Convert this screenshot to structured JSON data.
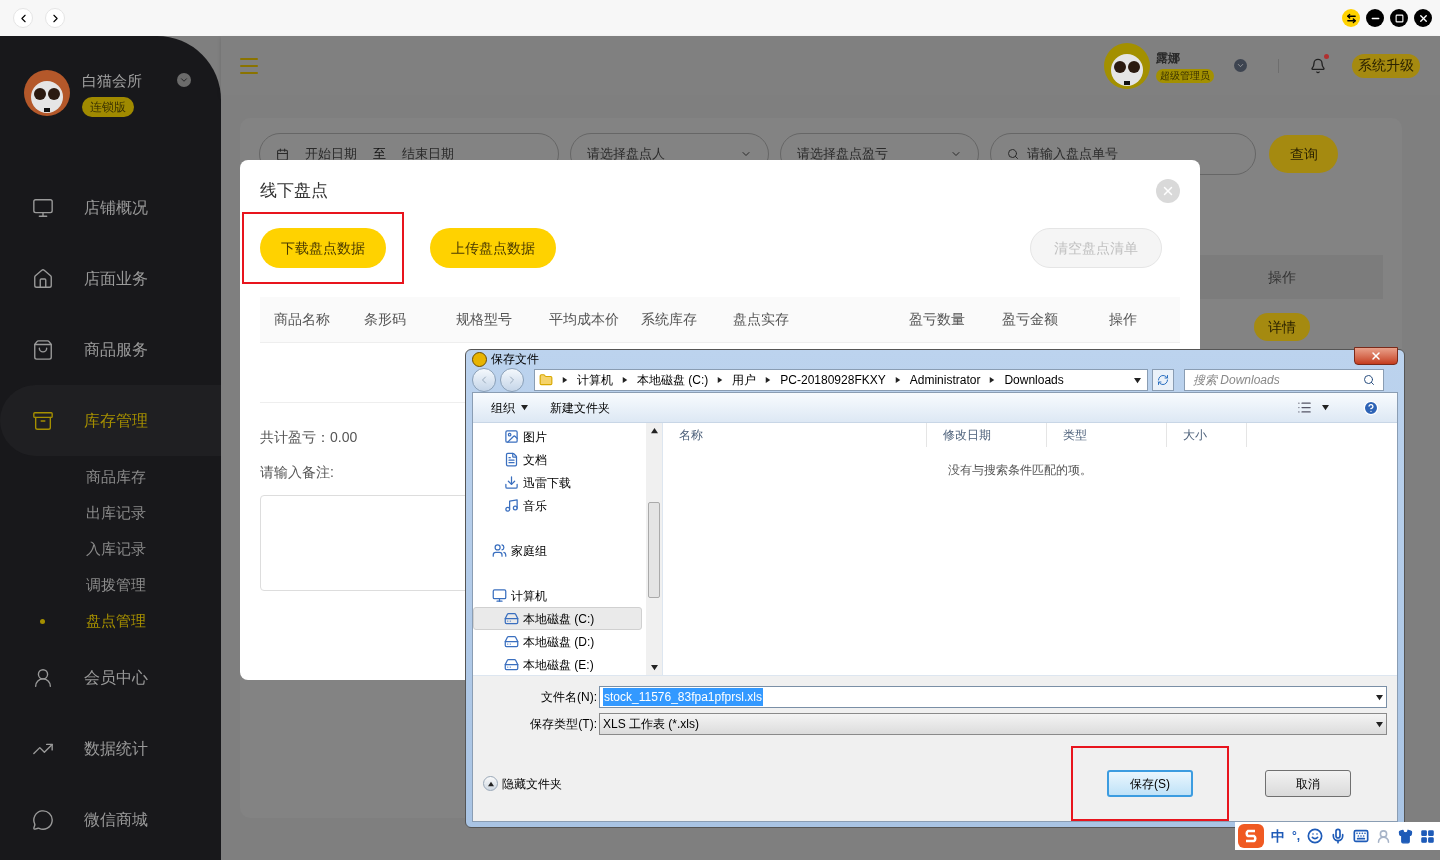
{
  "sidebar": {
    "shop_name": "白猫会所",
    "edition": "连锁版",
    "items": [
      {
        "label": "店铺概况",
        "selected": false
      },
      {
        "label": "店面业务",
        "selected": false
      },
      {
        "label": "商品服务",
        "selected": false
      },
      {
        "label": "库存管理",
        "selected": true,
        "expanded": true,
        "children": [
          {
            "label": "商品库存",
            "selected": false
          },
          {
            "label": "出库记录",
            "selected": false
          },
          {
            "label": "入库记录",
            "selected": false
          },
          {
            "label": "调拨管理",
            "selected": false
          },
          {
            "label": "盘点管理",
            "selected": true
          }
        ]
      },
      {
        "label": "会员中心",
        "selected": false
      },
      {
        "label": "数据统计",
        "selected": false
      },
      {
        "label": "微信商城",
        "selected": false
      }
    ]
  },
  "header": {
    "user_name": "露娜",
    "role": "超级管理员",
    "notification_unread": true,
    "upgrade_button": "系统升级"
  },
  "filters": {
    "start_date": "开始日期",
    "date_separator": "至",
    "end_date": "结束日期",
    "counter_select": "请选择盘点人",
    "profit_select": "请选择盘点盈亏",
    "order_search": "请输入盘点单号",
    "query_button": "查询"
  },
  "background_table": {
    "column": "操作",
    "row_action": "详情"
  },
  "modal": {
    "title": "线下盘点",
    "buttons": [
      {
        "label": "下载盘点数据",
        "disabled": false,
        "highlighted": true
      },
      {
        "label": "上传盘点数据",
        "disabled": false,
        "highlighted": false
      },
      {
        "label": "清空盘点清单",
        "disabled": true,
        "highlighted": false
      }
    ],
    "columns": [
      "商品名称",
      "条形码",
      "规格型号",
      "平均成本价",
      "系统库存",
      "盘点实存",
      "盈亏数量",
      "盈亏金额",
      "操作"
    ],
    "total": "共计盈亏：0.00",
    "remark_label": "请输入备注:"
  },
  "save_dialog": {
    "title": "保存文件",
    "breadcrumb": [
      "计算机",
      "本地磁盘 (C:)",
      "用户",
      "PC-20180928FKXY",
      "Administrator",
      "Downloads"
    ],
    "search_placeholder": "搜索 Downloads",
    "toolbar": {
      "organize": "组织",
      "new_folder": "新建文件夹"
    },
    "nav_tree": [
      {
        "children": [
          {
            "kind": "pictures",
            "label": "图片",
            "selected": false
          },
          {
            "kind": "documents",
            "label": "文档",
            "selected": false
          },
          {
            "kind": "downloads",
            "label": "迅雷下载",
            "selected": false
          },
          {
            "kind": "music",
            "label": "音乐",
            "selected": false
          }
        ]
      },
      {
        "kind": "homegroup",
        "label": "家庭组",
        "selected": false
      },
      {
        "kind": "computer",
        "label": "计算机",
        "selected": false,
        "children": [
          {
            "kind": "system_drive",
            "label": "本地磁盘 (C:)",
            "selected": true
          },
          {
            "kind": "drive",
            "label": "本地磁盘 (D:)",
            "selected": false
          },
          {
            "kind": "drive",
            "label": "本地磁盘 (E:)",
            "selected": false
          }
        ]
      }
    ],
    "columns": [
      "名称",
      "修改日期",
      "类型",
      "大小"
    ],
    "empty_message": "没有与搜索条件匹配的项。",
    "filename_label": "文件名(N):",
    "filename": "stock_11576_83fpa1pfprsl.xls",
    "filetype_label": "保存类型(T):",
    "filetype": "XLS 工作表 (*.xls)",
    "hide_folders": "隐藏文件夹",
    "buttons": [
      {
        "label": "保存(S)",
        "default": true,
        "highlighted": true
      },
      {
        "label": "取消",
        "default": false,
        "highlighted": false
      }
    ]
  },
  "ime_bar": {
    "mode": "中",
    "punctuation": "°,"
  }
}
